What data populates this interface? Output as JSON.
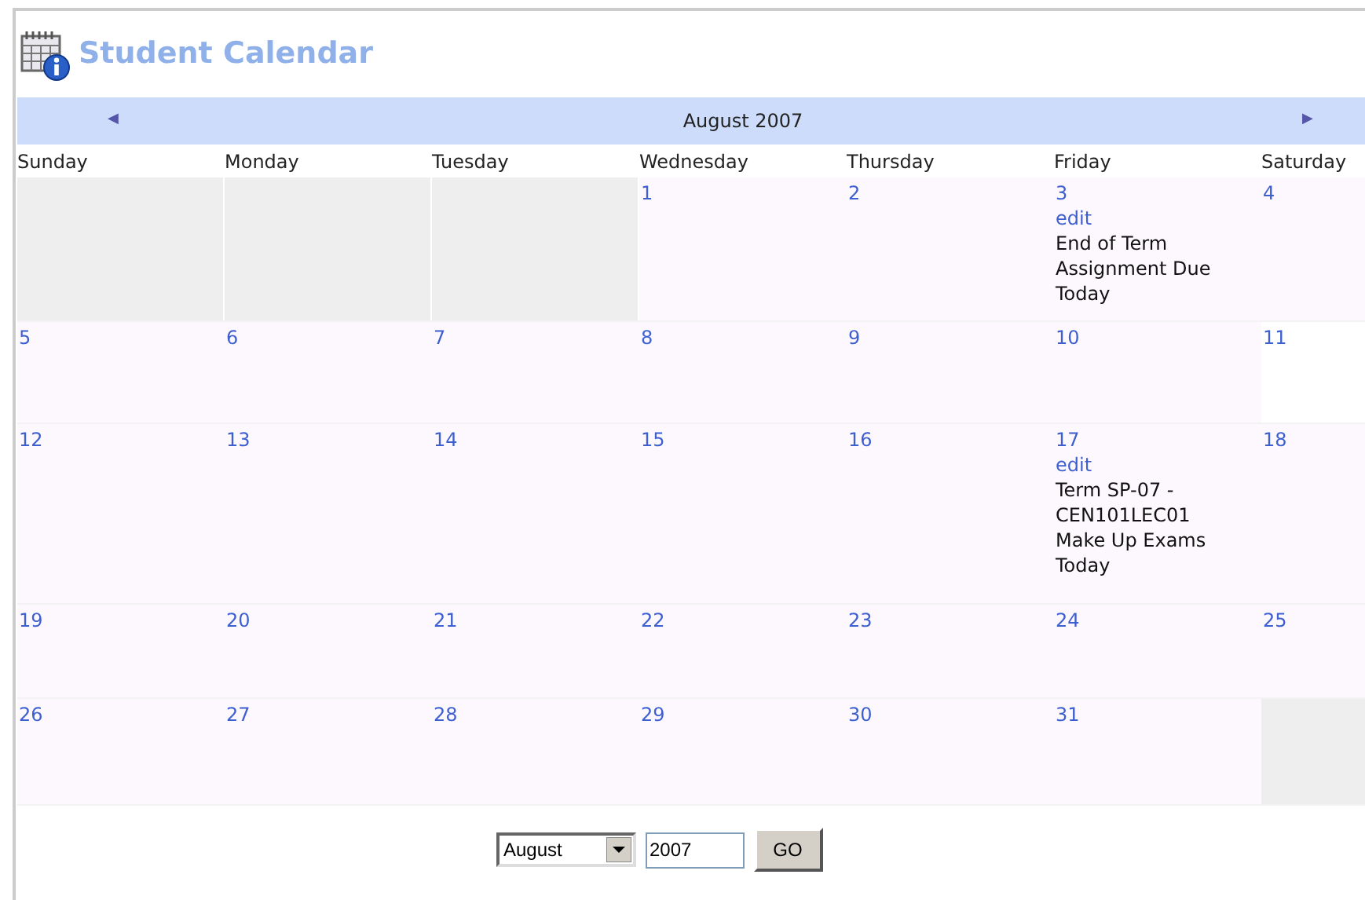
{
  "title": "Student Calendar",
  "nav": {
    "prev": "◀",
    "month": "August 2007",
    "next": "▶"
  },
  "weekdays": [
    "Sunday",
    "Monday",
    "Tuesday",
    "Wednesday",
    "Thursday",
    "Friday",
    "Saturday"
  ],
  "weeks": [
    [
      {
        "kind": "empty"
      },
      {
        "kind": "empty"
      },
      {
        "kind": "empty"
      },
      {
        "kind": "day",
        "day": "1"
      },
      {
        "kind": "day",
        "day": "2"
      },
      {
        "kind": "day",
        "day": "3",
        "events": [
          {
            "action": "edit",
            "text": "End of Term Assignment Due Today"
          }
        ]
      },
      {
        "kind": "day",
        "day": "4"
      }
    ],
    [
      {
        "kind": "day",
        "day": "5"
      },
      {
        "kind": "day",
        "day": "6"
      },
      {
        "kind": "day",
        "day": "7"
      },
      {
        "kind": "day",
        "day": "8"
      },
      {
        "kind": "day",
        "day": "9"
      },
      {
        "kind": "day",
        "day": "10"
      },
      {
        "kind": "day",
        "day": "11",
        "today": true
      }
    ],
    [
      {
        "kind": "day",
        "day": "12"
      },
      {
        "kind": "day",
        "day": "13"
      },
      {
        "kind": "day",
        "day": "14"
      },
      {
        "kind": "day",
        "day": "15"
      },
      {
        "kind": "day",
        "day": "16"
      },
      {
        "kind": "day",
        "day": "17",
        "events": [
          {
            "action": "edit",
            "text": "Term SP-07 - CEN101LEC01 Make Up Exams Today"
          }
        ]
      },
      {
        "kind": "day",
        "day": "18"
      }
    ],
    [
      {
        "kind": "day",
        "day": "19"
      },
      {
        "kind": "day",
        "day": "20"
      },
      {
        "kind": "day",
        "day": "21"
      },
      {
        "kind": "day",
        "day": "22"
      },
      {
        "kind": "day",
        "day": "23"
      },
      {
        "kind": "day",
        "day": "24"
      },
      {
        "kind": "day",
        "day": "25"
      }
    ],
    [
      {
        "kind": "day",
        "day": "26"
      },
      {
        "kind": "day",
        "day": "27"
      },
      {
        "kind": "day",
        "day": "28"
      },
      {
        "kind": "day",
        "day": "29"
      },
      {
        "kind": "day",
        "day": "30"
      },
      {
        "kind": "day",
        "day": "31"
      },
      {
        "kind": "empty"
      }
    ]
  ],
  "form": {
    "month": "August",
    "year": "2007",
    "button": "GO"
  }
}
